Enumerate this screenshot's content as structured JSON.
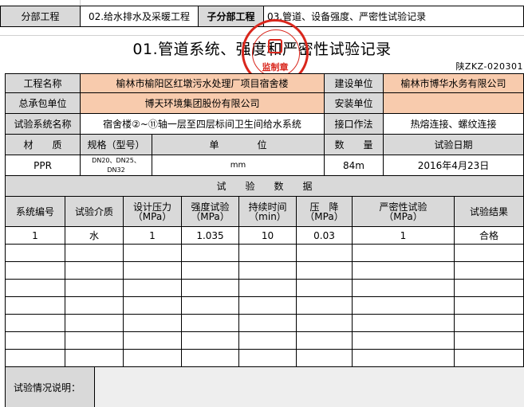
{
  "header": {
    "subdivision_label": "分部工程",
    "subdivision_value": "02.给水排水及采暖工程",
    "sub_subdivision_label": "子分部工程",
    "sub_subdivision_value": "03.管道、设备强度、严密性试验记录"
  },
  "form": {
    "title": "01.管道系统、强度和严密性试验记录",
    "form_code": "陕ZKZ-020301",
    "stamp_text": "监制章"
  },
  "info": {
    "project_name_label": "工程名称",
    "project_name_value": "榆林市榆阳区红墩污水处理厂项目宿舍楼",
    "owner_label": "建设单位",
    "owner_value": "榆林市博华水务有限公司",
    "contractor_label": "总承包单位",
    "contractor_value": "博天环境集团股份有限公司",
    "installer_label": "安装单位",
    "installer_value": "",
    "system_name_label": "试验系统名称",
    "system_name_value": "宿舍楼②~⑪轴一层至四层标间卫生间给水系统",
    "joint_label": "接口作法",
    "joint_value": "热熔连接、螺纹连接",
    "material_label": "材　　质",
    "spec_label": "规格（型号）",
    "unit_label": "单　　　　位",
    "qty_label": "数　　量",
    "date_label": "试验日期",
    "material_value": "PPR",
    "spec_value_line1": "DN20、DN25、",
    "spec_value_line2": "DN32",
    "unit_value": "mm",
    "qty_value": "84m",
    "date_value": "2016年4月23日"
  },
  "test": {
    "section_title": "试　　验　　数　　据",
    "columns": {
      "system_no": "系统编号",
      "medium": "试验介质",
      "design_pressure_1": "设计压力",
      "design_pressure_2": "（MPa）",
      "strength_1": "强度试验",
      "strength_2": "（MPa）",
      "duration_1": "持续时间",
      "duration_2": "（min）",
      "drop_1": "压　降",
      "drop_2": "（MPa）",
      "tightness_1": "严密性试验",
      "tightness_2": "（MPa）",
      "result": "试验结果"
    },
    "rows": [
      {
        "system_no": "1",
        "medium": "水",
        "design_pressure": "1",
        "strength": "1.035",
        "duration": "10",
        "drop": "0.03",
        "tightness": "1",
        "result": "合格"
      }
    ],
    "remarks_label": "试验情况说明："
  }
}
